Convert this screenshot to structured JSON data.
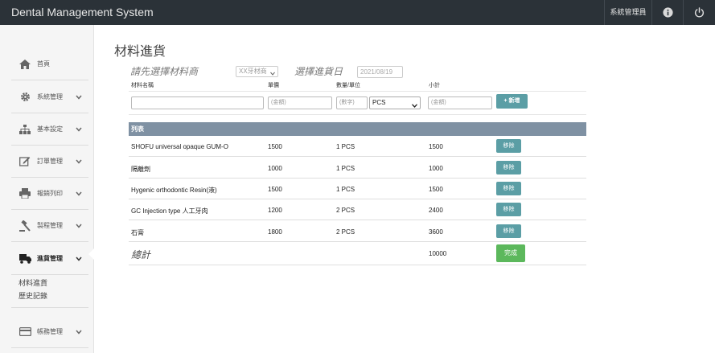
{
  "header": {
    "brand": "Dental Management System",
    "user_label": "系統管理員",
    "info_icon": "info-icon",
    "power_icon": "power-icon"
  },
  "sidebar": {
    "items": [
      {
        "label": "首頁",
        "icon": "home-icon"
      },
      {
        "label": "系統管理",
        "icon": "gear-icon"
      },
      {
        "label": "基本設定",
        "icon": "sitemap-icon"
      },
      {
        "label": "訂單管理",
        "icon": "edit-icon"
      },
      {
        "label": "報銷列印",
        "icon": "printer-icon"
      },
      {
        "label": "製程管理",
        "icon": "gavel-icon"
      },
      {
        "label": "進貨管理",
        "icon": "truck-icon"
      },
      {
        "label": "帳務管理",
        "icon": "credit-card-icon"
      }
    ],
    "subitems": [
      "材料進貨",
      "歷史記錄"
    ]
  },
  "main": {
    "title": "材料進貨",
    "vendor_hint": "請先選擇材料商",
    "vendor_selected": "XX牙材商",
    "date_hint": "選擇進貨日",
    "date_value": "2021/08/19",
    "columns": [
      "材料名稱",
      "單價",
      "數量/單位",
      "小計"
    ],
    "form": {
      "price_placeholder": "(金額)",
      "qty_placeholder": "(數字)",
      "unit_selected": "PCS",
      "subtotal_placeholder": "(金額)",
      "add_label": "+ 新增"
    },
    "list_title": "列表",
    "rows": [
      {
        "name": "SHOFU universal opaque GUM-O",
        "price": "1500",
        "qty": "1 PCS",
        "subtotal": "1500",
        "remove": "移除"
      },
      {
        "name": "隔離劑",
        "price": "1000",
        "qty": "1 PCS",
        "subtotal": "1000",
        "remove": "移除"
      },
      {
        "name": "Hygenic orthodontic Resin(液)",
        "price": "1500",
        "qty": "1 PCS",
        "subtotal": "1500",
        "remove": "移除"
      },
      {
        "name": "GC Injection type 人工牙肉",
        "price": "1200",
        "qty": "2 PCS",
        "subtotal": "2400",
        "remove": "移除"
      },
      {
        "name": "石膏",
        "price": "1800",
        "qty": "2 PCS",
        "subtotal": "3600",
        "remove": "移除"
      }
    ],
    "total_label": "總計",
    "total_value": "10000",
    "done_label": "完成"
  },
  "colors": {
    "topbar": "#2b3238",
    "list_header": "#7f91a3",
    "teal_button": "#5b9ea5",
    "done_button": "#5cb85c"
  }
}
